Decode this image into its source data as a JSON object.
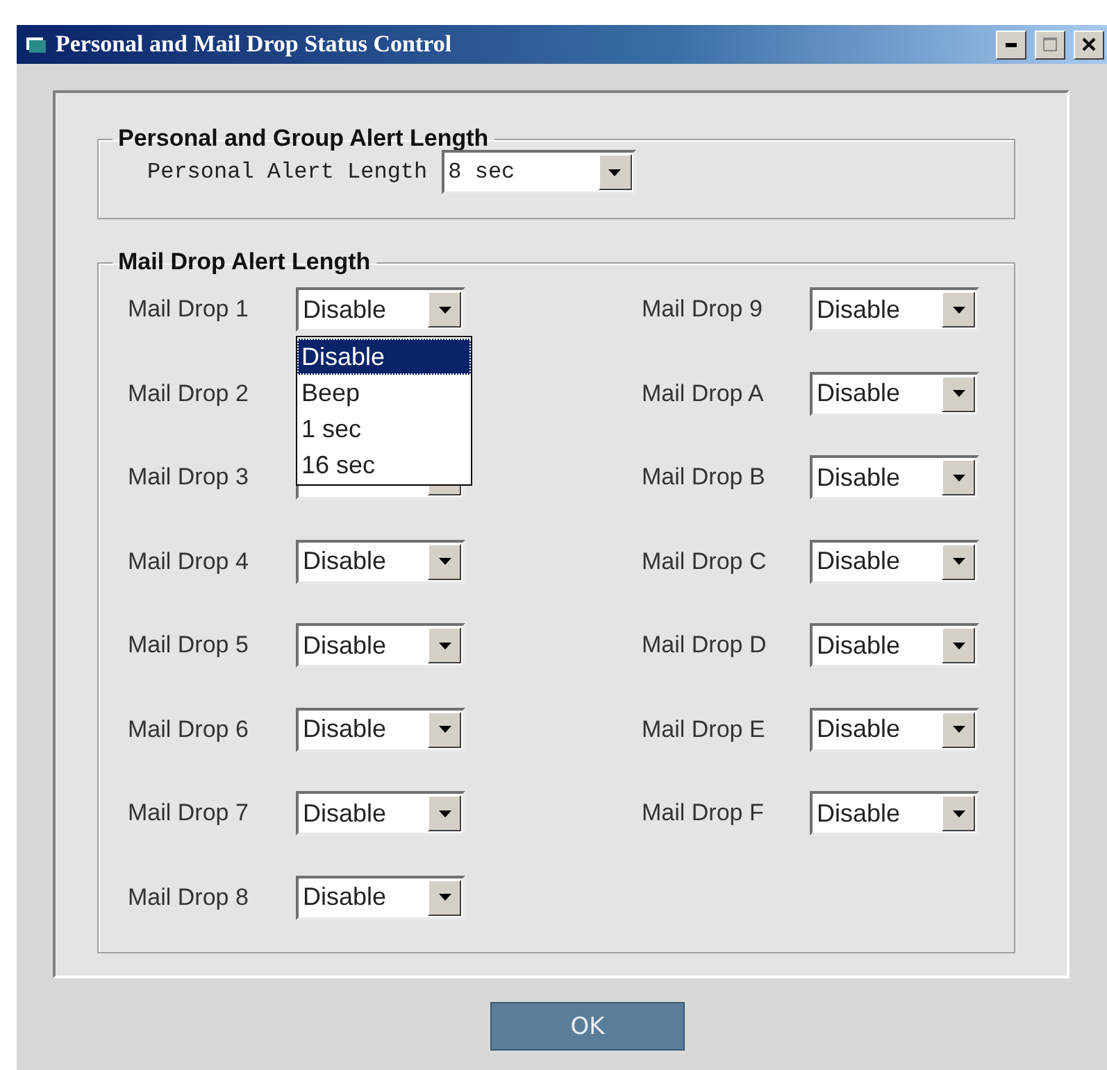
{
  "window": {
    "title": "Personal and Mail Drop Status Control"
  },
  "personal_group": {
    "title": "Personal and Group Alert Length",
    "label": "Personal Alert Length",
    "value": "8 sec"
  },
  "mail_drop_group": {
    "title": "Mail Drop Alert Length",
    "columns": [
      [
        {
          "label": "Mail Drop 1",
          "value": "Disable",
          "options": [
            {
              "label": "Disable",
              "selected": true
            },
            {
              "label": "Beep",
              "selected": false
            },
            {
              "label": "1 sec",
              "selected": false
            },
            {
              "label": "16 sec",
              "selected": false
            }
          ]
        },
        {
          "label": "Mail Drop 2"
        },
        {
          "label": "Mail Drop 3"
        },
        {
          "label": "Mail Drop 4",
          "value": "Disable"
        },
        {
          "label": "Mail Drop 5",
          "value": "Disable"
        },
        {
          "label": "Mail Drop 6",
          "value": "Disable"
        },
        {
          "label": "Mail Drop 7",
          "value": "Disable"
        },
        {
          "label": "Mail Drop 8",
          "value": "Disable"
        }
      ],
      [
        {
          "label": "Mail Drop 9",
          "value": "Disable"
        },
        {
          "label": "Mail Drop A",
          "value": "Disable"
        },
        {
          "label": "Mail Drop B",
          "value": "Disable"
        },
        {
          "label": "Mail Drop C",
          "value": "Disable"
        },
        {
          "label": "Mail Drop D",
          "value": "Disable"
        },
        {
          "label": "Mail Drop E",
          "value": "Disable"
        },
        {
          "label": "Mail Drop F",
          "value": "Disable"
        }
      ]
    ]
  },
  "ok_button": "OK"
}
